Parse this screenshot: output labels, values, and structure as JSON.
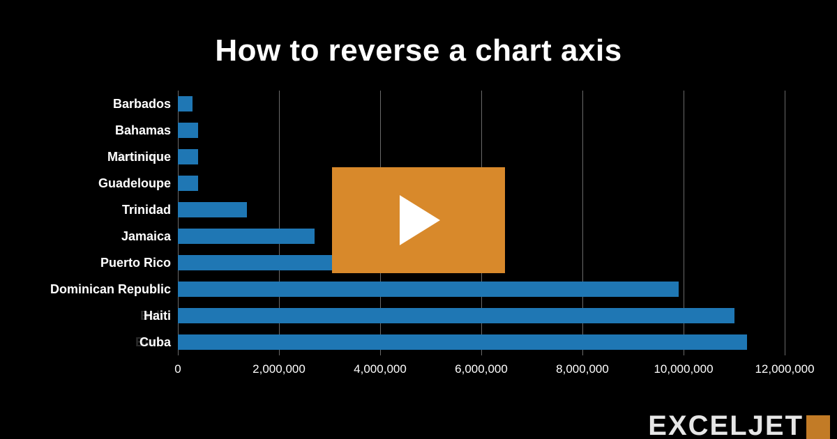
{
  "title": "How to reverse a chart axis",
  "brand": "EXCELJET",
  "play_label": "Play",
  "chart_data": {
    "type": "bar",
    "title": "How to reverse a chart axis",
    "xlabel": "",
    "ylabel": "",
    "xlim": [
      0,
      12000000
    ],
    "categories": [
      "Barbados",
      "Bahamas",
      "Martinique",
      "Guadeloupe",
      "Trinidad",
      "Jamaica",
      "Puerto Rico",
      "Dominican Republic",
      "Haiti",
      "Cuba"
    ],
    "values": [
      285000,
      395000,
      400000,
      405000,
      1370000,
      2700000,
      3400000,
      9900000,
      11000000,
      11250000
    ],
    "x_ticks": [
      0,
      2000000,
      4000000,
      6000000,
      8000000,
      10000000,
      12000000
    ],
    "x_tick_labels": [
      "0",
      "2,000,000",
      "4,000,000",
      "6,000,000",
      "8,000,000",
      "10,000,000",
      "12,000,000"
    ],
    "ghost_labels": {
      "2": "Dominic",
      "8": "Bah",
      "9": "Barb"
    }
  },
  "colors": {
    "bar": "#1f77b4",
    "accent": "#d8892b",
    "grid": "#6a6a6a"
  }
}
